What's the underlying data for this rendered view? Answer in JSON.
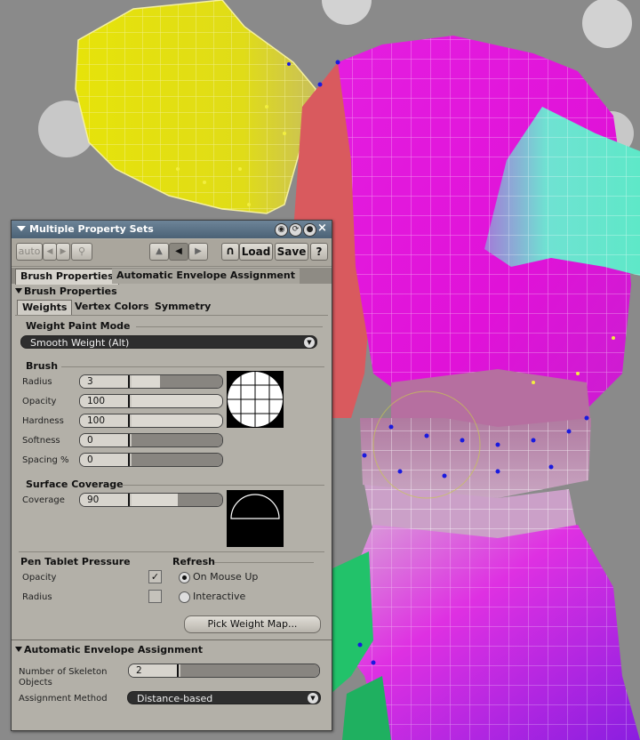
{
  "panel": {
    "title": "Multiple Property Sets",
    "toolbar": {
      "auto_label": "auto",
      "load_label": "Load",
      "save_label": "Save",
      "help_label": "?"
    },
    "tabs": [
      {
        "label": "Brush Properties"
      },
      {
        "label": "Automatic Envelope Assignment"
      }
    ],
    "brush_section": {
      "header": "Brush Properties",
      "subtabs": [
        {
          "label": "Weights"
        },
        {
          "label": "Vertex Colors"
        },
        {
          "label": "Symmetry"
        }
      ],
      "weight_paint_mode": {
        "title": "Weight Paint Mode",
        "value": "Smooth Weight (Alt)"
      },
      "brush": {
        "title": "Brush",
        "fields": [
          {
            "label": "Radius",
            "value": "3",
            "fraction": 0.3
          },
          {
            "label": "Opacity",
            "value": "100",
            "fraction": 1.0
          },
          {
            "label": "Hardness",
            "value": "100",
            "fraction": 1.0
          },
          {
            "label": "Softness",
            "value": "0",
            "fraction": 0.0
          },
          {
            "label": "Spacing %",
            "value": "0",
            "fraction": 0.0
          }
        ]
      },
      "surface_coverage": {
        "title": "Surface Coverage",
        "label": "Coverage",
        "value": "90",
        "fraction": 0.5
      },
      "pen_tablet": {
        "title": "Pen Tablet Pressure",
        "opacity_label": "Opacity",
        "opacity_checked": true,
        "radius_label": "Radius",
        "radius_checked": false
      },
      "refresh": {
        "title": "Refresh",
        "options": [
          {
            "label": "On Mouse Up",
            "selected": true
          },
          {
            "label": "Interactive",
            "selected": false
          }
        ]
      },
      "pick_weight_map_label": "Pick Weight Map..."
    },
    "envelope_section": {
      "header": "Automatic Envelope Assignment",
      "skeleton_label_line1": "Number of Skeleton",
      "skeleton_label_line2": "Objects",
      "skeleton_value": "2",
      "assignment_label": "Assignment Method",
      "assignment_value": "Distance-based"
    }
  }
}
